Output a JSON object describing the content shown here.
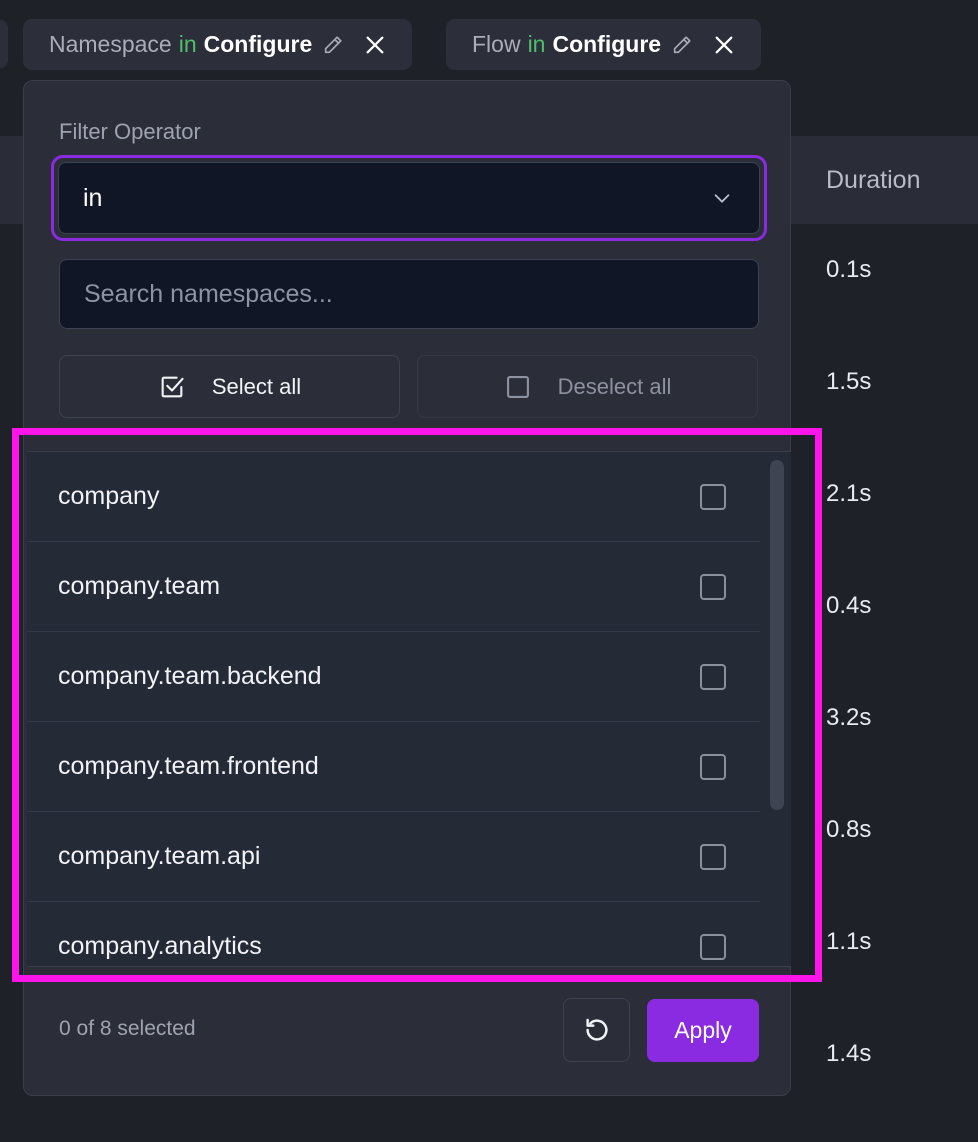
{
  "chips": [
    {
      "field": "Namespace",
      "operator": "in",
      "value": "Configure"
    },
    {
      "field": "Flow",
      "operator": "in",
      "value": "Configure"
    }
  ],
  "table": {
    "duration_header": "Duration",
    "durations": [
      "0.1s",
      "1.5s",
      "2.1s",
      "0.4s",
      "3.2s",
      "0.8s",
      "1.1s",
      "1.4s"
    ]
  },
  "popover": {
    "operator_label": "Filter Operator",
    "operator_value": "in",
    "search_placeholder": "Search namespaces...",
    "select_all_label": "Select all",
    "deselect_all_label": "Deselect all",
    "items": [
      {
        "label": "company",
        "checked": false
      },
      {
        "label": "company.team",
        "checked": false
      },
      {
        "label": "company.team.backend",
        "checked": false
      },
      {
        "label": "company.team.frontend",
        "checked": false
      },
      {
        "label": "company.team.api",
        "checked": false
      },
      {
        "label": "company.analytics",
        "checked": false
      }
    ],
    "selection_status": "0 of 8 selected",
    "apply_label": "Apply"
  },
  "colors": {
    "accent": "#8a2be2",
    "operator_green": "#4fbf6a",
    "highlight": "#ff14ea"
  }
}
